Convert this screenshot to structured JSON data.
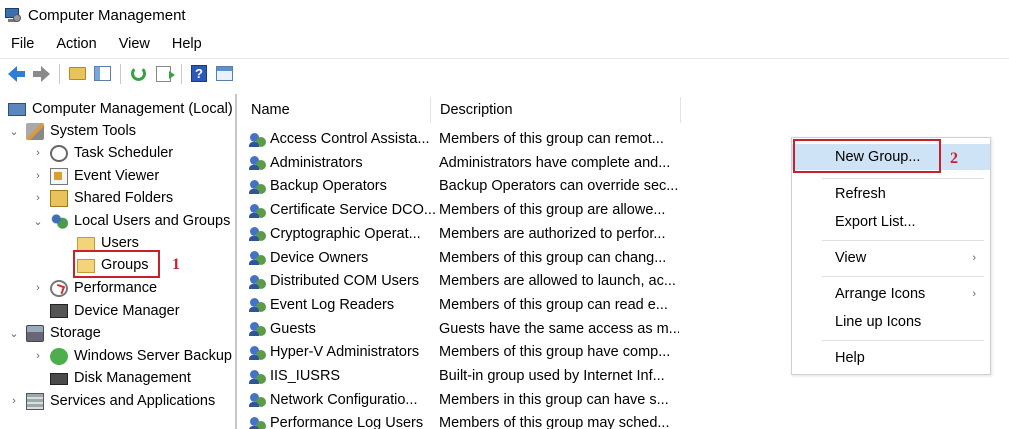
{
  "window": {
    "title": "Computer Management"
  },
  "menubar": [
    "File",
    "Action",
    "View",
    "Help"
  ],
  "toolbar": {
    "icons": [
      "back-arrow-icon",
      "forward-arrow-icon",
      "folder-up-icon",
      "show-hide-tree-icon",
      "refresh-icon",
      "export-list-icon",
      "help-icon",
      "action-pane-icon"
    ]
  },
  "tree": {
    "items": [
      {
        "label": "Computer Management (Local)",
        "icon": "computer-icon",
        "chevron": ""
      },
      {
        "label": "System Tools",
        "icon": "tools-icon",
        "chevron": "⌄"
      },
      {
        "label": "Task Scheduler",
        "icon": "clock-icon",
        "chevron": "›"
      },
      {
        "label": "Event Viewer",
        "icon": "event-viewer-icon",
        "chevron": "›"
      },
      {
        "label": "Shared Folders",
        "icon": "shared-folder-icon",
        "chevron": "›"
      },
      {
        "label": "Local Users and Groups",
        "icon": "users-icon",
        "chevron": "⌄"
      },
      {
        "label": "Users",
        "icon": "folder-icon",
        "chevron": ""
      },
      {
        "label": "Groups",
        "icon": "folder-icon",
        "chevron": ""
      },
      {
        "label": "Performance",
        "icon": "performance-icon",
        "chevron": "›"
      },
      {
        "label": "Device Manager",
        "icon": "device-manager-icon",
        "chevron": ""
      },
      {
        "label": "Storage",
        "icon": "storage-icon",
        "chevron": "⌄"
      },
      {
        "label": "Windows Server Backup",
        "icon": "backup-icon",
        "chevron": "›"
      },
      {
        "label": "Disk Management",
        "icon": "disk-icon",
        "chevron": ""
      },
      {
        "label": "Services and Applications",
        "icon": "services-icon",
        "chevron": "›"
      }
    ]
  },
  "annotations": {
    "one": "1",
    "two": "2"
  },
  "list": {
    "columns": {
      "name": "Name",
      "description": "Description"
    },
    "rows": [
      {
        "name": "Access Control Assista...",
        "description": "Members of this group can remot..."
      },
      {
        "name": "Administrators",
        "description": "Administrators have complete and..."
      },
      {
        "name": "Backup Operators",
        "description": "Backup Operators can override sec..."
      },
      {
        "name": "Certificate Service DCO...",
        "description": "Members of this group are allowe..."
      },
      {
        "name": "Cryptographic Operat...",
        "description": "Members are authorized to perfor..."
      },
      {
        "name": "Device Owners",
        "description": "Members of this group can chang..."
      },
      {
        "name": "Distributed COM Users",
        "description": "Members are allowed to launch, ac..."
      },
      {
        "name": "Event Log Readers",
        "description": "Members of this group can read e..."
      },
      {
        "name": "Guests",
        "description": "Guests have the same access as m..."
      },
      {
        "name": "Hyper-V Administrators",
        "description": "Members of this group have comp..."
      },
      {
        "name": "IIS_IUSRS",
        "description": "Built-in group used by Internet Inf..."
      },
      {
        "name": "Network Configuratio...",
        "description": "Members in this group can have s..."
      },
      {
        "name": "Performance Log Users",
        "description": "Members of this group may sched..."
      }
    ]
  },
  "context_menu": {
    "new_group": "New Group...",
    "refresh": "Refresh",
    "export_list": "Export List...",
    "view": "View",
    "arrange_icons": "Arrange Icons",
    "line_up_icons": "Line up Icons",
    "help": "Help",
    "submenu_arrow": "›"
  },
  "colors": {
    "highlight_box": "#c9212b",
    "menu_hover": "#cfe3f7"
  }
}
